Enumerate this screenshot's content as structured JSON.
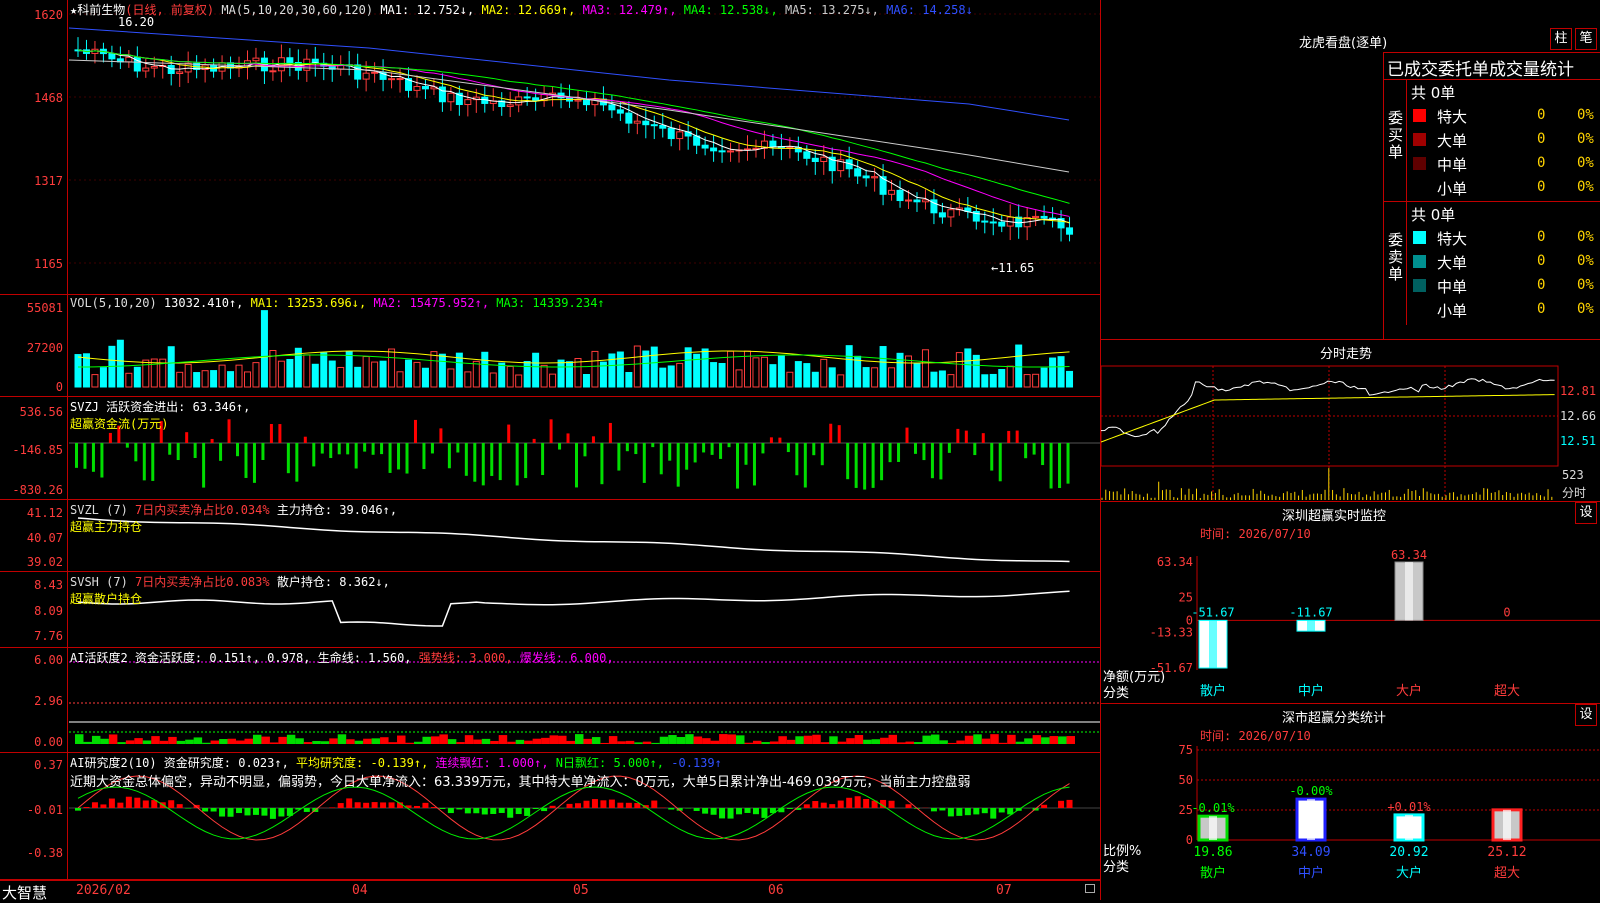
{
  "stock": {
    "title": "★科前生物",
    "mode": "(日线, 前复权)"
  },
  "main_panel": {
    "ticks": [
      "1620",
      "1468",
      "1317",
      "1165"
    ],
    "ma_legend": [
      {
        "text": "MA(5,10,20,30,60,120)",
        "color": "#dddddd"
      },
      {
        "text": "MA1: 12.752↓,",
        "color": "#ffffff"
      },
      {
        "text": "MA2: 12.669↑,",
        "color": "#ffff00"
      },
      {
        "text": "MA3: 12.479↑,",
        "color": "#ff00ff"
      },
      {
        "text": "MA4: 12.538↓,",
        "color": "#00ff00"
      },
      {
        "text": "MA5: 13.275↓,",
        "color": "#cccccc"
      },
      {
        "text": "MA6: 14.258↓",
        "color": "#3050ff"
      }
    ],
    "high_label": "16.20",
    "low_label": "←11.65"
  },
  "vol_panel": {
    "ticks": [
      "55081",
      "27200",
      "0"
    ],
    "legend": [
      {
        "text": "VOL(5,10,20)",
        "color": "#dddddd"
      },
      {
        "text": "13032.410↑,",
        "color": "#ffffff"
      },
      {
        "text": "MA1: 13253.696↓,",
        "color": "#ffff00"
      },
      {
        "text": "MA2: 15475.952↑,",
        "color": "#ff00ff"
      },
      {
        "text": "MA3: 14339.234↑",
        "color": "#00ff00"
      }
    ]
  },
  "svzj_panel": {
    "ticks": [
      "536.56",
      "-146.85",
      "-830.26"
    ],
    "legend": [
      {
        "text": "SVZJ  活跃资金进出: 63.346↑,",
        "color": "#ffffff"
      }
    ],
    "sub_label": "超赢资金流(万元)"
  },
  "svzl_panel": {
    "ticks": [
      "41.12",
      "40.07",
      "39.02"
    ],
    "legend": [
      {
        "text": "SVZL (7)",
        "color": "#dddddd"
      },
      {
        "text": "7日内买卖净占比0.034%",
        "color": "#ff3c3c"
      },
      {
        "text": "主力持仓: 39.046↑,",
        "color": "#ffffff"
      }
    ],
    "sub_label": "超赢主力持仓"
  },
  "svsh_panel": {
    "ticks": [
      "8.43",
      "8.09",
      "7.76"
    ],
    "legend": [
      {
        "text": "SVSH (7)",
        "color": "#dddddd"
      },
      {
        "text": "7日内买卖净占比0.083%",
        "color": "#ff3c3c"
      },
      {
        "text": "散户持仓: 8.362↓,",
        "color": "#ffffff"
      }
    ],
    "sub_label": "超赢散户持仓"
  },
  "ai_active_panel": {
    "ticks": [
      "6.00",
      "2.96",
      "0.00"
    ],
    "legend": [
      {
        "text": "AI活跃度2 资金活跃度: 0.151↑, 0.978, 生命线: 1.560,",
        "color": "#ffffff"
      },
      {
        "text": "强势线: 3.000,",
        "color": "#ff3c3c"
      },
      {
        "text": "爆发线: 6.000,",
        "color": "#ff00ff"
      }
    ]
  },
  "ai_research_panel": {
    "ticks": [
      "0.37",
      "-0.01",
      "-0.38"
    ],
    "legend": [
      {
        "text": "AI研究度2(10) 资金研究度: 0.023↑,",
        "color": "#ffffff"
      },
      {
        "text": "平均研究度: -0.139↑,",
        "color": "#ffff00"
      },
      {
        "text": "连续飘红: 1.000↑,",
        "color": "#ff00ff"
      },
      {
        "text": "N日飘红: 5.000↑,",
        "color": "#00ff00"
      },
      {
        "text": "-0.139↑",
        "color": "#3050ff"
      }
    ],
    "summary": "近期大资金总体偏空，异动不明显，偏弱势，今日大单净流入：63.339万元，其中特大单净流入：0万元，大单5日累计净出-469.039万元，当前主力控盘弱"
  },
  "date_axis": {
    "brand": "大智慧",
    "labels": [
      "2026/02",
      "04",
      "05",
      "06",
      "07"
    ]
  },
  "right": {
    "dragon_title": "龙虎看盘(逐单)",
    "btn_col": "柱",
    "btn_pen": "笔",
    "order_header": "已成交委托单成交量统计",
    "buy": {
      "side_label": "委买单",
      "total": "共 0单",
      "rows": [
        {
          "label": "特大",
          "count": "0",
          "pct": "0%",
          "color": "#ff0000"
        },
        {
          "label": "大单",
          "count": "0",
          "pct": "0%",
          "color": "#a00000"
        },
        {
          "label": "中单",
          "count": "0",
          "pct": "0%",
          "color": "#600000"
        },
        {
          "label": "小单",
          "count": "0",
          "pct": "0%",
          "color": ""
        }
      ]
    },
    "sell": {
      "side_label": "委卖单",
      "total": "共 0单",
      "rows": [
        {
          "label": "特大",
          "count": "0",
          "pct": "0%",
          "color": "#00ffff"
        },
        {
          "label": "大单",
          "count": "0",
          "pct": "0%",
          "color": "#009090"
        },
        {
          "label": "中单",
          "count": "0",
          "pct": "0%",
          "color": "#006060"
        },
        {
          "label": "小单",
          "count": "0",
          "pct": "0%",
          "color": ""
        }
      ]
    },
    "intraday": {
      "title": "分时走势",
      "prices": [
        "12.81",
        "12.66",
        "12.51"
      ],
      "vol": "523",
      "vol_unit": "分时"
    },
    "monitor": {
      "title": "深圳超赢实时监控",
      "btn": "设",
      "time": "时间: 2026/07/10",
      "ticks": [
        "63.34",
        "25",
        "0",
        "-13.33",
        "-51.67"
      ],
      "unit_label": "净额(万元)",
      "class_label": "分类",
      "categories": [
        "散户",
        "中户",
        "大户",
        "超大"
      ],
      "values": [
        -51.67,
        -11.67,
        63.34,
        0
      ],
      "value_labels": [
        "-51.67",
        "-11.67",
        "63.34",
        "0"
      ]
    },
    "classify": {
      "title": "深市超赢分类统计",
      "btn": "设",
      "time": "时间: 2026/07/10",
      "ticks": [
        "75",
        "50",
        "25",
        "0"
      ],
      "ratio_label": "比例%",
      "class_label": "分类",
      "categories": [
        "散户",
        "中户",
        "大户",
        "超大"
      ],
      "values": [
        19.86,
        34.09,
        20.92,
        25.12
      ],
      "deltas": [
        "-0.01%",
        "-0.00%",
        "+0.01%",
        ""
      ]
    }
  }
}
